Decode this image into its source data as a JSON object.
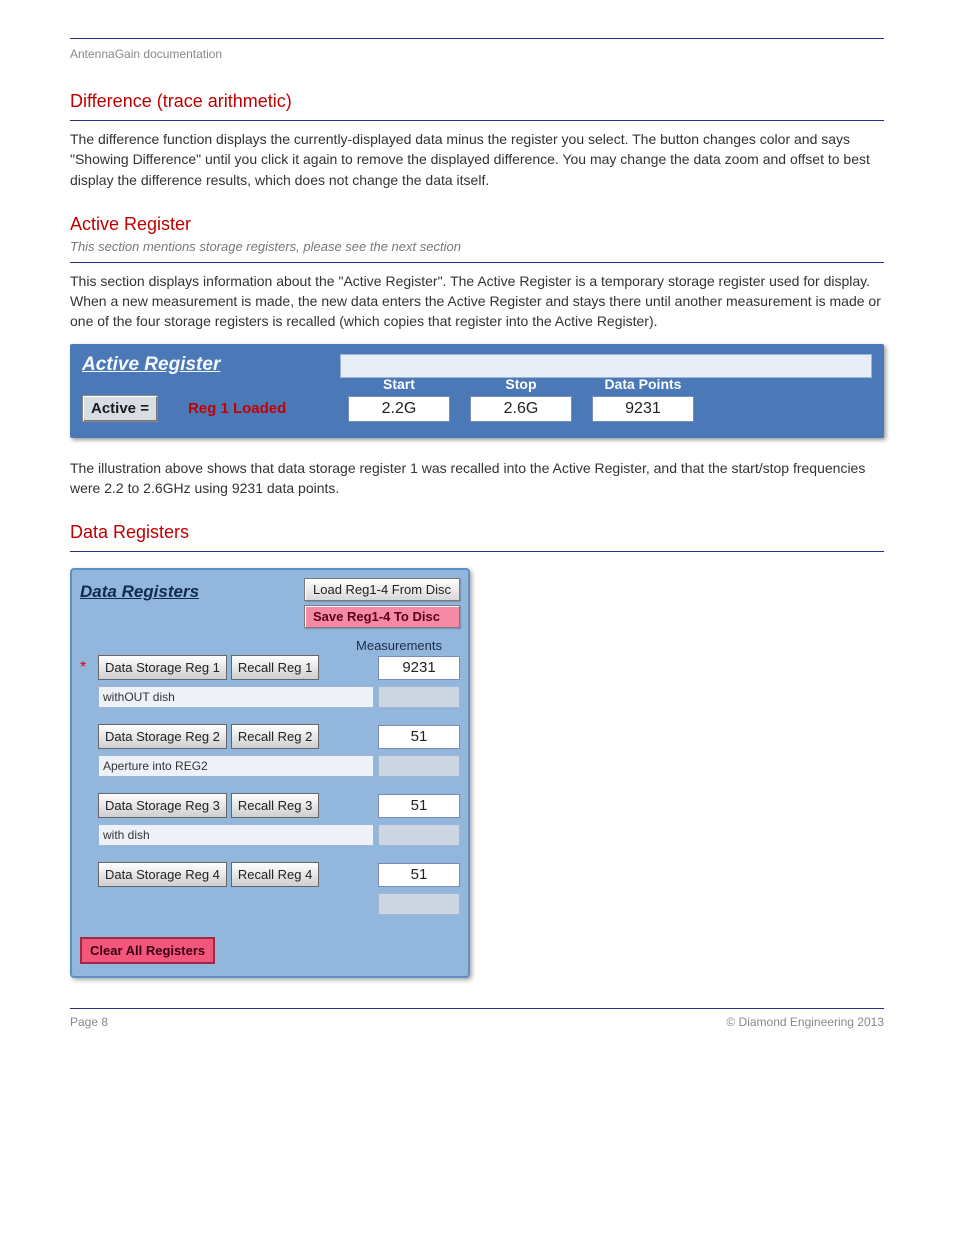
{
  "header": {
    "doctitle": "AntennaGain documentation"
  },
  "sections": {
    "difference": {
      "title": "Difference (trace arithmetic)",
      "subtitle": "",
      "body": "The difference function displays the currently-displayed data minus the register you select. The button changes color and says \"Showing Difference\" until you click it again to remove the displayed difference. You may change the data zoom and offset to best display the difference results, which does not change the data itself."
    },
    "active_register": {
      "title": "Active Register",
      "subtitle": "This section mentions storage registers, please see the next section",
      "body": "This section displays information about the \"Active Register\". The Active Register is a temporary storage register used for display. When a new measurement is made, the new data enters the Active Register and stays there until another measurement is made or one of the four storage registers is recalled (which copies that register into the Active Register).",
      "body2": "The illustration above shows that data storage register 1 was recalled into the Active Register, and that the start/stop frequencies were 2.2 to 2.6GHz using 9231 data points.",
      "panel": {
        "title": "Active Register",
        "active_label": "Active =",
        "loaded": "Reg 1 Loaded",
        "start_label": "Start",
        "start_value": "2.2G",
        "stop_label": "Stop",
        "stop_value": "2.6G",
        "points_label": "Data Points",
        "points_value": "9231"
      }
    },
    "data_registers": {
      "title": "Data Registers",
      "panel": {
        "title": "Data Registers",
        "load_btn": "Load Reg1-4 From Disc",
        "save_btn": "Save Reg1-4 To Disc",
        "meas_header": "Measurements",
        "clear_btn": "Clear All Registers",
        "registers": [
          {
            "starred": true,
            "store": "Data Storage Reg 1",
            "recall": "Recall Reg 1",
            "meas": "9231",
            "note": "withOUT dish"
          },
          {
            "starred": false,
            "store": "Data Storage Reg 2",
            "recall": "Recall Reg 2",
            "meas": "51",
            "note": "Aperture into REG2"
          },
          {
            "starred": false,
            "store": "Data Storage Reg 3",
            "recall": "Recall Reg 3",
            "meas": "51",
            "note": "with dish"
          },
          {
            "starred": false,
            "store": "Data Storage Reg 4",
            "recall": "Recall Reg 4",
            "meas": "51",
            "note": ""
          }
        ]
      }
    }
  },
  "footer": {
    "left": "Page 8",
    "right": "© Diamond Engineering 2013"
  }
}
